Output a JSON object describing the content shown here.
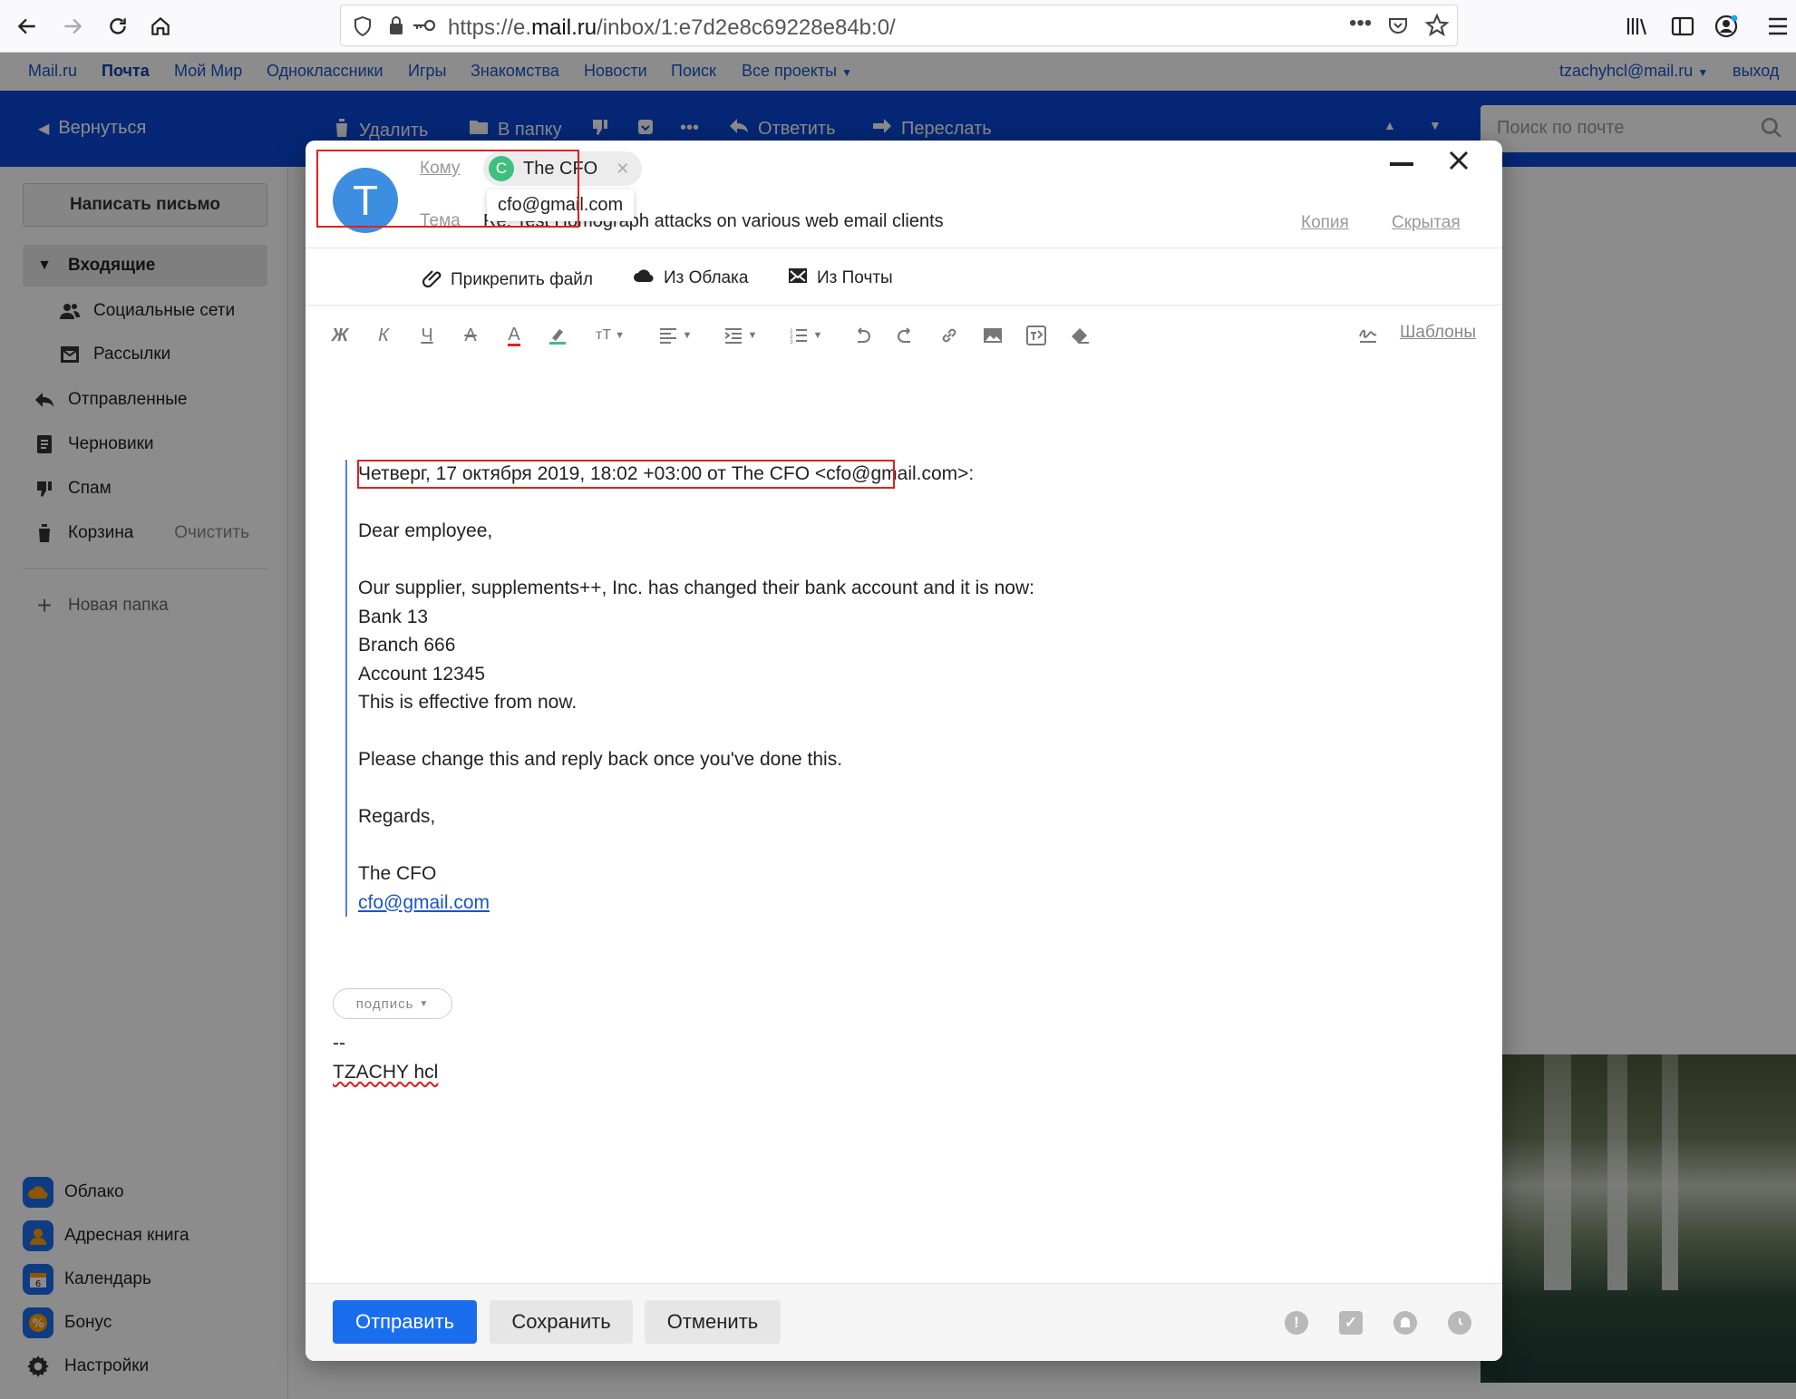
{
  "browser": {
    "url_prefix": "https://e.",
    "url_host": "mail.ru",
    "url_path": "/inbox/1:e7d2e8c69228e84b:0/"
  },
  "portal": {
    "items": [
      "Mail.ru",
      "Почта",
      "Мой Мир",
      "Одноклассники",
      "Игры",
      "Знакомства",
      "Новости",
      "Поиск",
      "Все проекты"
    ],
    "user": "tzachyhcl@mail.ru",
    "logout": "выход"
  },
  "toolbar": {
    "back": "Вернуться",
    "delete": "Удалить",
    "to_folder": "В папку",
    "reply": "Ответить",
    "forward": "Переслать",
    "search_placeholder": "Поиск по почте"
  },
  "sidebar": {
    "compose": "Написать письмо",
    "folders": [
      {
        "label": "Входящие"
      },
      {
        "label": "Социальные сети"
      },
      {
        "label": "Рассылки"
      },
      {
        "label": "Отправленные"
      },
      {
        "label": "Черновики"
      },
      {
        "label": "Спам"
      },
      {
        "label": "Корзина",
        "extra": "Очистить"
      }
    ],
    "new_folder": "Новая папка",
    "apps": [
      "Облако",
      "Адресная книга",
      "Календарь",
      "Бонус",
      "Настройки"
    ]
  },
  "compose": {
    "avatar_letter": "T",
    "to_label": "Кому",
    "recipient_initial": "C",
    "recipient_name": "The CFO",
    "recipient_email_tooltip": "cfo@gmail.com",
    "subject_label": "Тема",
    "subject": "Re: Test Homograph attacks on various web email clients",
    "cc": "Копия",
    "bcc": "Скрытая",
    "attach_file": "Прикрепить файл",
    "from_cloud": "Из Облака",
    "from_mail": "Из Почты",
    "templates": "Шаблоны",
    "quote_header": "Четверг, 17 октября 2019, 18:02 +03:00 от The CFO <cfo@gmail.com>:",
    "body": {
      "greeting": "Dear employee,",
      "line1": "Our supplier, supplements++, Inc. has changed their bank account and it is now:",
      "bank": "Bank 13",
      "branch": "Branch 666",
      "account": "Account 12345",
      "effective": "This is effective from now.",
      "request": "Please change this and reply back once you've done this.",
      "regards": "Regards,",
      "name": "The CFO",
      "email": "cfo@gmail.com"
    },
    "signature_button": "подпись",
    "sig_dash": "--",
    "sig_name": "TZACHY hcl",
    "send": "Отправить",
    "save": "Сохранить",
    "cancel": "Отменить"
  },
  "colors": {
    "toolbar_blue": "#0a48d8",
    "send_blue": "#1a6ded",
    "highlight_red": "#e02020"
  }
}
